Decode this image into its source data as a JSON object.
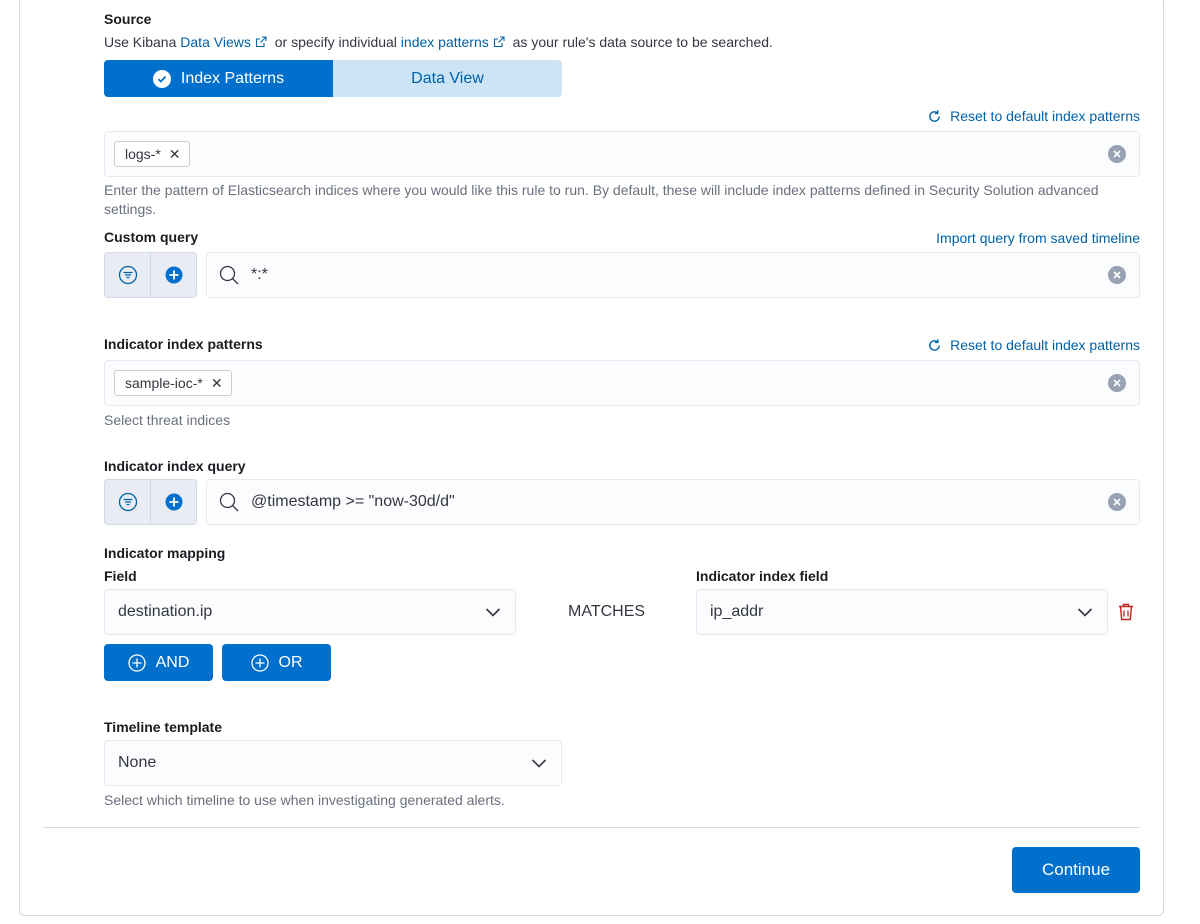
{
  "source": {
    "label": "Source",
    "desc_prefix": "Use Kibana",
    "link_data_views": "Data Views",
    "desc_mid": "or specify individual",
    "link_index_patterns": "index patterns",
    "desc_suffix": "as your rule's data source to be searched."
  },
  "toggle": {
    "index_patterns": "Index Patterns",
    "data_view": "Data View",
    "selected": "Index Patterns"
  },
  "index_patterns": {
    "reset_label": "Reset to default index patterns",
    "pills": [
      "logs-*"
    ],
    "help": "Enter the pattern of Elasticsearch indices where you would like this rule to run. By default, these will include index patterns defined in Security Solution advanced settings."
  },
  "custom_query": {
    "label": "Custom query",
    "import_link": "Import query from saved timeline",
    "value": "*:*"
  },
  "indicator_index_patterns": {
    "label": "Indicator index patterns",
    "reset_label": "Reset to default index patterns",
    "pills": [
      "sample-ioc-*"
    ],
    "help": "Select threat indices"
  },
  "indicator_query": {
    "label": "Indicator index query",
    "value": "@timestamp >= \"now-30d/d\""
  },
  "indicator_mapping": {
    "label": "Indicator mapping",
    "field_label": "Field",
    "field_value": "destination.ip",
    "matches": "MATCHES",
    "index_field_label": "Indicator index field",
    "index_field_value": "ip_addr",
    "and_label": "AND",
    "or_label": "OR"
  },
  "timeline": {
    "label": "Timeline template",
    "value": "None",
    "help": "Select which timeline to use when investigating generated alerts."
  },
  "footer": {
    "continue_label": "Continue"
  },
  "colors": {
    "primary": "#0070cc",
    "link": "#0061a6",
    "danger": "#bd271e"
  }
}
